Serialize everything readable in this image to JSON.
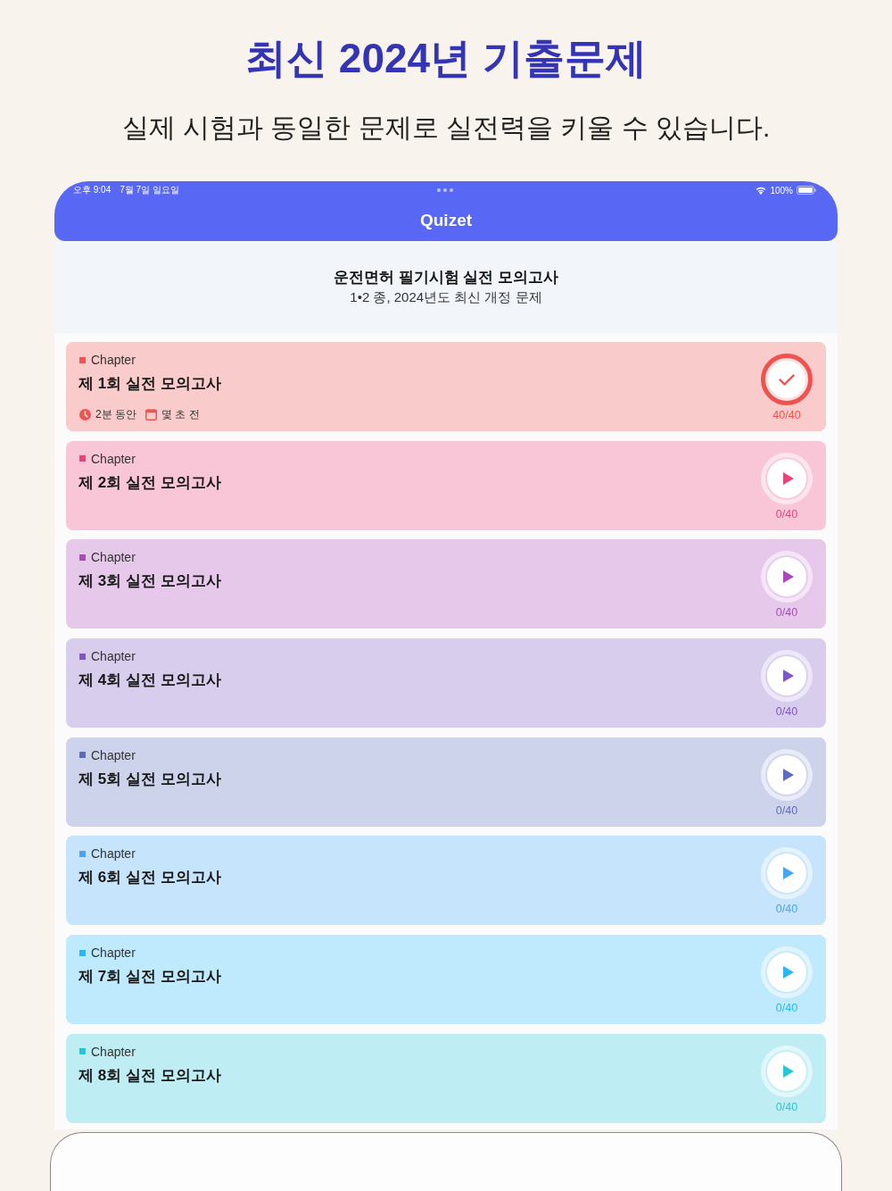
{
  "headline": {
    "title": "최신 2024년 기출문제",
    "subtitle": "실제 시험과 동일한 문제로 실전력을 키울 수 있습니다."
  },
  "status_bar": {
    "time": "오후 9:04",
    "date": "7월 7일 일요일",
    "battery": "100%"
  },
  "app_bar": {
    "title": "Quizet"
  },
  "intro": {
    "title": "운전면허 필기시험 실전 모의고사",
    "subtitle": "1•2 종, 2024년도 최신 개정 문제"
  },
  "chapters": [
    {
      "tag": "Chapter",
      "title": "제 1회 실전 모의고사",
      "color": "#ef5350",
      "completed": true,
      "progress": "40/40",
      "duration": "2분 동안",
      "last_played": "몇 초 전"
    },
    {
      "tag": "Chapter",
      "title": "제 2회 실전 모의고사",
      "color": "#ec407a",
      "completed": false,
      "progress": "0/40"
    },
    {
      "tag": "Chapter",
      "title": "제 3회 실전 모의고사",
      "color": "#ab47bc",
      "completed": false,
      "progress": "0/40"
    },
    {
      "tag": "Chapter",
      "title": "제 4회 실전 모의고사",
      "color": "#7e57c2",
      "completed": false,
      "progress": "0/40"
    },
    {
      "tag": "Chapter",
      "title": "제 5회 실전 모의고사",
      "color": "#5c6bc0",
      "completed": false,
      "progress": "0/40"
    },
    {
      "tag": "Chapter",
      "title": "제 6회 실전 모의고사",
      "color": "#42a5f5",
      "completed": false,
      "progress": "0/40"
    },
    {
      "tag": "Chapter",
      "title": "제 7회 실전 모의고사",
      "color": "#29b6f6",
      "completed": false,
      "progress": "0/40"
    },
    {
      "tag": "Chapter",
      "title": "제 8회 실전 모의고사",
      "color": "#26c6da",
      "completed": false,
      "progress": "0/40"
    }
  ]
}
